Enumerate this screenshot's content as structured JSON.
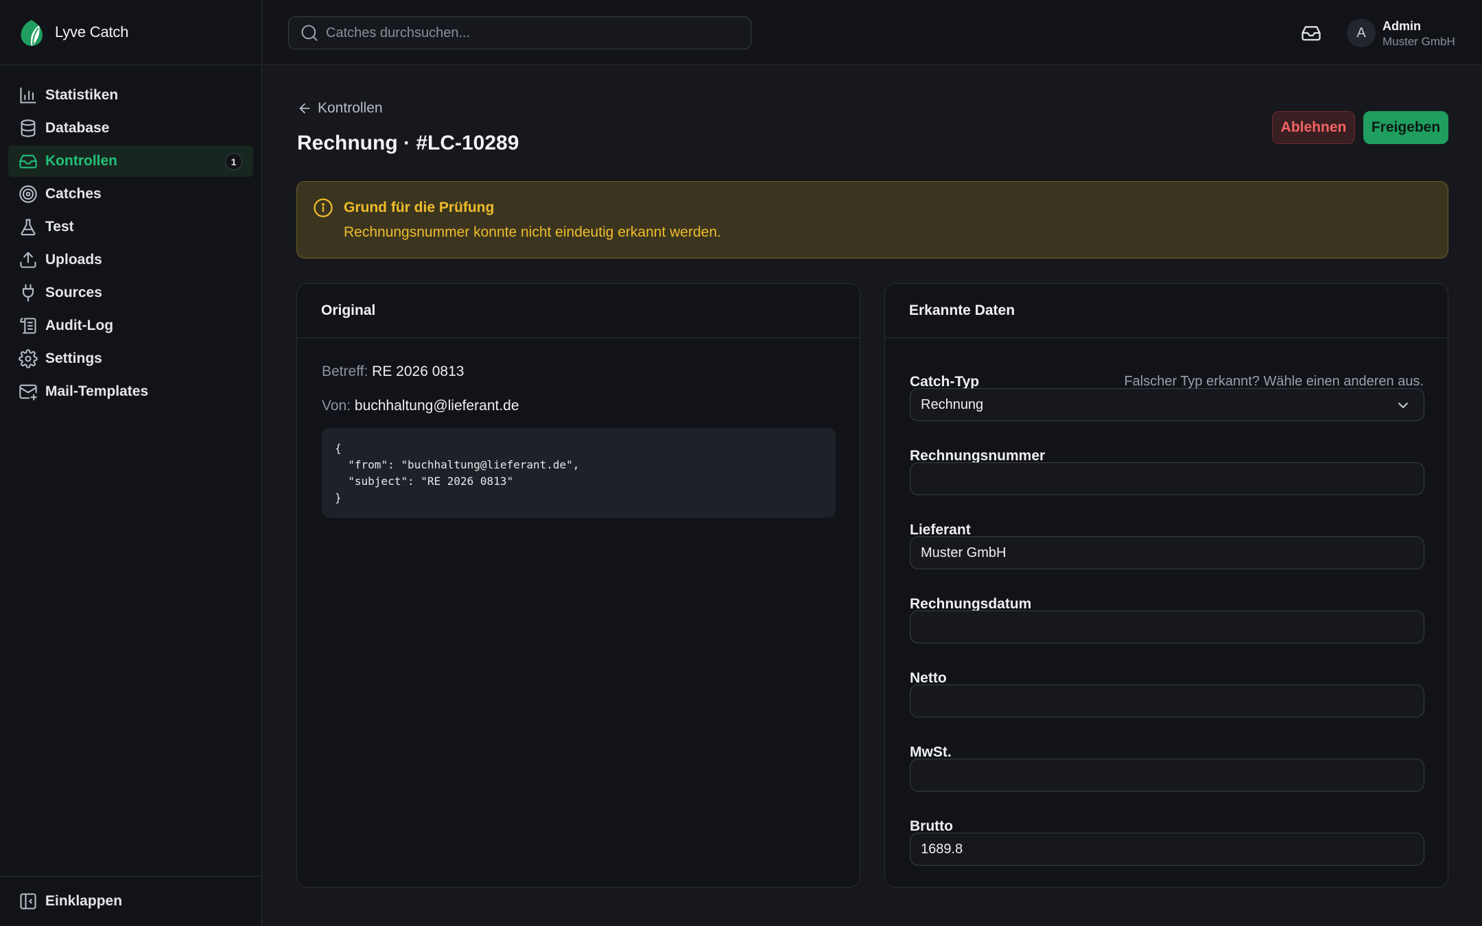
{
  "app": {
    "name": "Lyve Catch"
  },
  "colors": {
    "accent": "#22c07a",
    "danger": "#f26464",
    "warning": "#f0bd2a"
  },
  "sidebar": {
    "items": [
      {
        "label": "Statistiken",
        "icon": "bar-chart-icon"
      },
      {
        "label": "Database",
        "icon": "database-icon"
      },
      {
        "label": "Kontrollen",
        "icon": "inbox-icon",
        "active": true,
        "badge": "1"
      },
      {
        "label": "Catches",
        "icon": "target-icon"
      },
      {
        "label": "Test",
        "icon": "flask-icon"
      },
      {
        "label": "Uploads",
        "icon": "upload-icon"
      },
      {
        "label": "Sources",
        "icon": "plug-icon"
      },
      {
        "label": "Audit-Log",
        "icon": "scroll-icon"
      },
      {
        "label": "Settings",
        "icon": "gear-icon"
      },
      {
        "label": "Mail-Templates",
        "icon": "mail-plus-icon"
      }
    ],
    "collapse_label": "Einklappen"
  },
  "header": {
    "search_placeholder": "Catches durchsuchen...",
    "user": {
      "initial": "A",
      "name": "Admin",
      "org": "Muster GmbH"
    }
  },
  "page": {
    "back_label": "Kontrollen",
    "title": "Rechnung · #LC-10289",
    "reject_label": "Ablehnen",
    "approve_label": "Freigeben"
  },
  "alert": {
    "title": "Grund für die Prüfung",
    "text": "Rechnungsnummer konnte nicht eindeutig erkannt werden."
  },
  "original": {
    "title": "Original",
    "subject_label": "Betreff:",
    "subject": "RE 2026 0813",
    "from_label": "Von:",
    "from": "buchhaltung@lieferant.de",
    "raw_json": "{\n  \"from\": \"buchhaltung@lieferant.de\",\n  \"subject\": \"RE 2026 0813\"\n}"
  },
  "detected": {
    "title": "Erkannte Daten",
    "type_label": "Catch-Typ",
    "type_hint": "Falscher Typ erkannt? Wähle einen anderen aus.",
    "type_value": "Rechnung",
    "fields": [
      {
        "label": "Rechnungsnummer",
        "value": ""
      },
      {
        "label": "Lieferant",
        "value": "Muster GmbH"
      },
      {
        "label": "Rechnungsdatum",
        "value": ""
      },
      {
        "label": "Netto",
        "value": ""
      },
      {
        "label": "MwSt.",
        "value": ""
      },
      {
        "label": "Brutto",
        "value": "1689.8"
      }
    ]
  }
}
